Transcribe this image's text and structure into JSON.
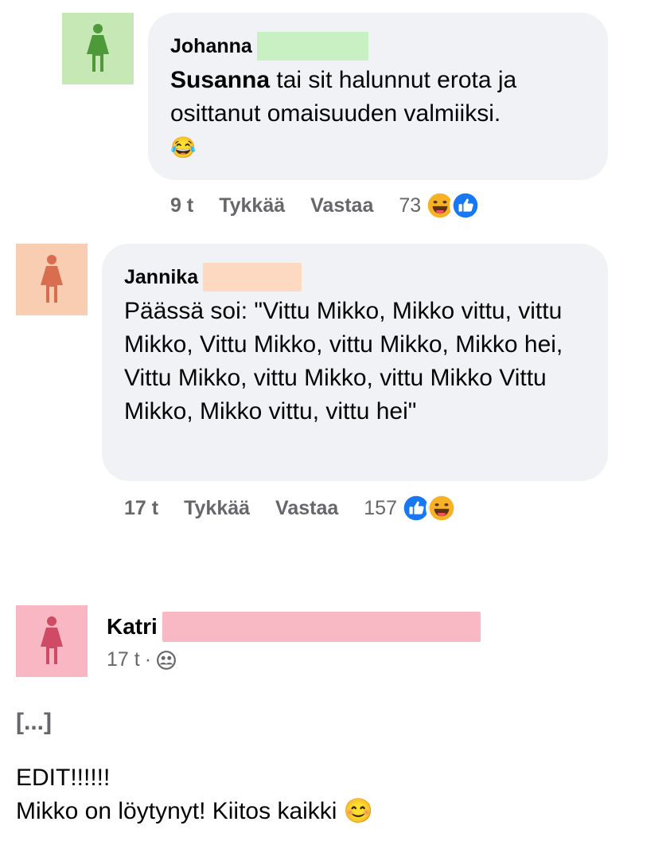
{
  "comments": [
    {
      "author": "Johanna",
      "mention": "Susanna",
      "text": " tai sit halunnut erota ja osittanut omaisuuden valmiiksi.",
      "emoji": "😂",
      "time": "9 t",
      "like_label": "Tykkää",
      "reply_label": "Vastaa",
      "reaction_count": "73",
      "reactions": [
        "haha-icon",
        "like-icon"
      ],
      "avatar_color": "#c5e8b4",
      "figure_color": "#4e9a3a",
      "redact_color": "#c9f0c2"
    },
    {
      "author": "Jannika",
      "text": "Päässä soi: \"Vittu Mikko, Mikko vittu, vittu Mikko, Vittu Mikko, vittu Mikko, Mikko hei, Vittu Mikko, vittu Mikko, vittu Mikko Vittu Mikko, Mikko vittu, vittu hei\"",
      "time": "17 t",
      "like_label": "Tykkää",
      "reply_label": "Vastaa",
      "reaction_count": "157",
      "reactions": [
        "like-icon",
        "haha-icon"
      ],
      "avatar_color": "#f9cdb1",
      "figure_color": "#d96d4f",
      "redact_color": "#fcd9c0"
    }
  ],
  "post": {
    "author": "Katri",
    "time": "17 t",
    "separator": "·",
    "audience_icon": "friends-icon",
    "ellipsis": "[...]",
    "edit_line": "EDIT!!!!!!",
    "message": "Mikko on löytynyt! Kiitos kaikki",
    "emoji": "😊",
    "avatar_color": "#f8b7c2",
    "figure_color": "#cf4a64",
    "redact_color": "#f8b8c4"
  },
  "colors": {
    "like": "#1877f2",
    "haha": "#f7b125",
    "bubble": "#f0f2f5",
    "meta": "#65676b"
  }
}
